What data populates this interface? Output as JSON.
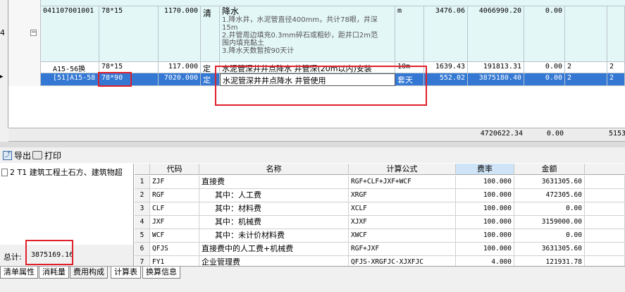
{
  "top_table": {
    "rows": [
      {
        "row_num": "4",
        "code": "041107001001",
        "spec": "78*15",
        "qty": "1170.000",
        "type": "清",
        "name_title": "降水",
        "name_lines": [
          "1.降水井，水泥管直径400mm，共计78眼，井深",
          "15m",
          "2.井管周边填充0.3mm碎石或粗砂，距井口2m范",
          "围内填充黏土",
          "3.降水天数暂按90天计"
        ],
        "unit": "m",
        "price": "3476.06",
        "total": "4066990.20",
        "zero": "0.00"
      },
      {
        "code": "A15-56换",
        "spec": "78*15",
        "qty": "117.000",
        "type": "定",
        "name": "水泥管深井井点降水 井管深(20m以内)安装",
        "unit": "10m",
        "price": "1639.43",
        "total": "191813.31",
        "zero": "0.00",
        "extra1": "2",
        "extra2": "2"
      },
      {
        "code": "[51]A15-58",
        "spec": "78*90",
        "qty": "7020.000",
        "type": "定",
        "name": "水泥管深井井点降水 井管使用",
        "unit": "套天",
        "price": "552.02",
        "total": "3875180.40",
        "zero": "0.00",
        "extra1": "2",
        "extra2": "2"
      }
    ],
    "summary": {
      "total": "4720622.34",
      "zero": "0.00",
      "trunc": "5153"
    }
  },
  "toolbar": {
    "export_label": "导出",
    "print_label": "打印"
  },
  "tree": {
    "item_label": "2 T1 建筑工程土石方、建筑物超"
  },
  "total": {
    "label": "总计:",
    "value": "3875169.16"
  },
  "fee_table": {
    "headers": [
      "代码",
      "名称",
      "计算公式",
      "费率",
      "金额"
    ],
    "rows": [
      {
        "n": "1",
        "code": "ZJF",
        "name": "直接费",
        "formula": "RGF+CLF+JXF+WCF",
        "rate": "100.000",
        "amount": "3631305.60"
      },
      {
        "n": "2",
        "code": "RGF",
        "name": "其中：人工费",
        "formula": "XRGF",
        "rate": "100.000",
        "amount": "472305.60"
      },
      {
        "n": "3",
        "code": "CLF",
        "name": "其中：材料费",
        "formula": "XCLF",
        "rate": "100.000",
        "amount": "0.00"
      },
      {
        "n": "4",
        "code": "JXF",
        "name": "其中：机械费",
        "formula": "XJXF",
        "rate": "100.000",
        "amount": "3159000.00"
      },
      {
        "n": "5",
        "code": "WCF",
        "name": "其中：未计价材料费",
        "formula": "XWCF",
        "rate": "100.000",
        "amount": "0.00"
      },
      {
        "n": "6",
        "code": "QFJS",
        "name": "直接费中的人工费+机械费",
        "formula": "RGF+JXF",
        "rate": "100.000",
        "amount": "3631305.60"
      },
      {
        "n": "7",
        "code": "FY1",
        "name": "企业管理费",
        "formula": "QFJS-XRGFJC-XJXFJC",
        "rate": "4.000",
        "amount": "121931.78"
      }
    ]
  },
  "tabs": [
    "清单属性",
    "消耗量",
    "费用构成",
    "计算表",
    "换算信息"
  ],
  "colors": {
    "selection": "#3478d4",
    "highlight_box": "#e0202a",
    "row_cyan": "#e4f7f7"
  }
}
